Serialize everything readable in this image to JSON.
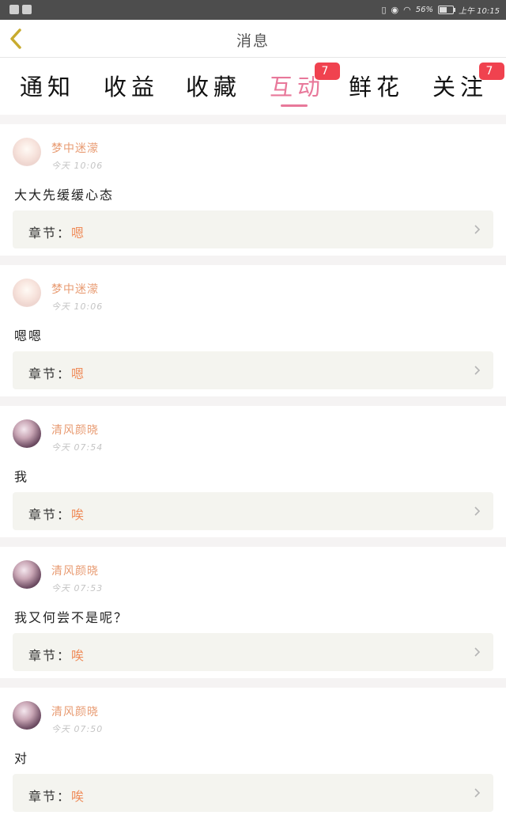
{
  "status_bar": {
    "battery_percent": "56%",
    "battery_level": 0.56,
    "time": "上午 10:15"
  },
  "header": {
    "title": "消息"
  },
  "tabs": [
    {
      "label": "通知",
      "badge": ""
    },
    {
      "label": "收益",
      "badge": ""
    },
    {
      "label": "收藏",
      "badge": ""
    },
    {
      "label": "互动",
      "badge": "7",
      "active": true
    },
    {
      "label": "鲜花",
      "badge": ""
    },
    {
      "label": "关注",
      "badge": "7"
    }
  ],
  "messages": [
    {
      "user": "梦中迷濛",
      "time": "今天 10:06",
      "text": "大大先缓缓心态",
      "chapter_label": "章节：",
      "chapter": "嗯"
    },
    {
      "user": "梦中迷濛",
      "time": "今天 10:06",
      "text": "嗯嗯",
      "chapter_label": "章节：",
      "chapter": "嗯"
    },
    {
      "user": "清风颜晓",
      "time": "今天 07:54",
      "text": "我",
      "chapter_label": "章节：",
      "chapter": "唉"
    },
    {
      "user": "清风颜晓",
      "time": "今天 07:53",
      "text": "我又何尝不是呢？",
      "chapter_label": "章节：",
      "chapter": "唉"
    },
    {
      "user": "清风颜晓",
      "time": "今天 07:50",
      "text": "对",
      "chapter_label": "章节：",
      "chapter": "唉"
    }
  ],
  "colors": {
    "accent": "#e8789a",
    "badge": "#f0424f",
    "username": "#e89b72",
    "chapter_value": "#ef8c5a"
  }
}
